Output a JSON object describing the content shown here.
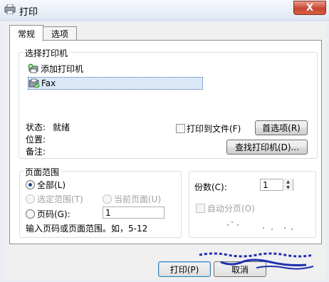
{
  "window": {
    "title": "打印",
    "close_glyph": "X"
  },
  "tabs": [
    {
      "label": "常规"
    },
    {
      "label": "选项"
    }
  ],
  "select_printer": {
    "group_label": "选择打印机",
    "printers": [
      {
        "name": "添加打印机"
      },
      {
        "name": "Fax"
      }
    ],
    "status_label": "状态:",
    "status_value": "就绪",
    "location_label": "位置:",
    "comment_label": "备注:",
    "print_to_file_label": "打印到文件(F)",
    "preferences_button": "首选项(R)",
    "find_printer_button": "查找打印机(D)..."
  },
  "page_range": {
    "group_label": "页面范围",
    "all_label": "全部(L)",
    "selection_label": "选定范围(T)",
    "current_page_label": "当前页面(U)",
    "pages_label": "页码(G):",
    "pages_value": "1",
    "hint": "输入页码或页面范围。如，5-12"
  },
  "copies": {
    "label": "份数(C):",
    "value": "1",
    "collate_label": "自动分页(O)"
  },
  "buttons": {
    "print": "打印(P)",
    "cancel": "取消"
  }
}
